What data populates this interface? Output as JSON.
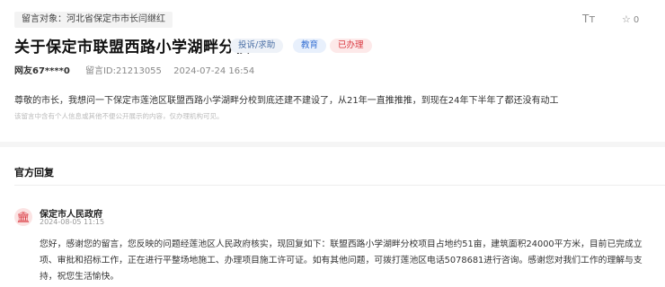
{
  "header": {
    "target_tag": "留言对象：河北省保定市市长闫继红",
    "font_size_icon_label": "Tт",
    "favorite_count": "0"
  },
  "message": {
    "title": "关于保定市联盟西路小学湖畔分校",
    "badges": [
      "投诉/求助",
      "教育",
      "已办理"
    ],
    "user": "网友67****0",
    "message_id": "留言ID:21213055",
    "datetime": "2024-07-24 16:54",
    "content": "尊敬的市长，我想问一下保定市莲池区联盟西路小学湖畔分校到底还建不建设了，从21年一直推推推，到现在24年下半年了都还没有动工",
    "notice": "该留言中含有个人信息或其他不便公开展示的内容，仅办理机构可见。"
  },
  "reply_section": {
    "title": "官方回复",
    "org_name": "保定市人民政府",
    "reply_time": "2024-08-05 11:15",
    "reply_text": "您好，感谢您的留言，您反映的问题经莲池区人民政府核实，现回复如下：联盟西路小学湖畔分校项目占地约51亩，建筑面积24000平方米，目前已完成立项、审批和招标工作，正在进行平整场地施工、办理项目施工许可证。如有其他问题，可拨打莲池区电话5078681进行咨询。感谢您对我们工作的理解与支持，祝您生活愉快。"
  },
  "colors": {
    "badge_blue": "#4a6fa5",
    "badge_edu": "#3a73d4",
    "badge_done": "#d9363e"
  }
}
